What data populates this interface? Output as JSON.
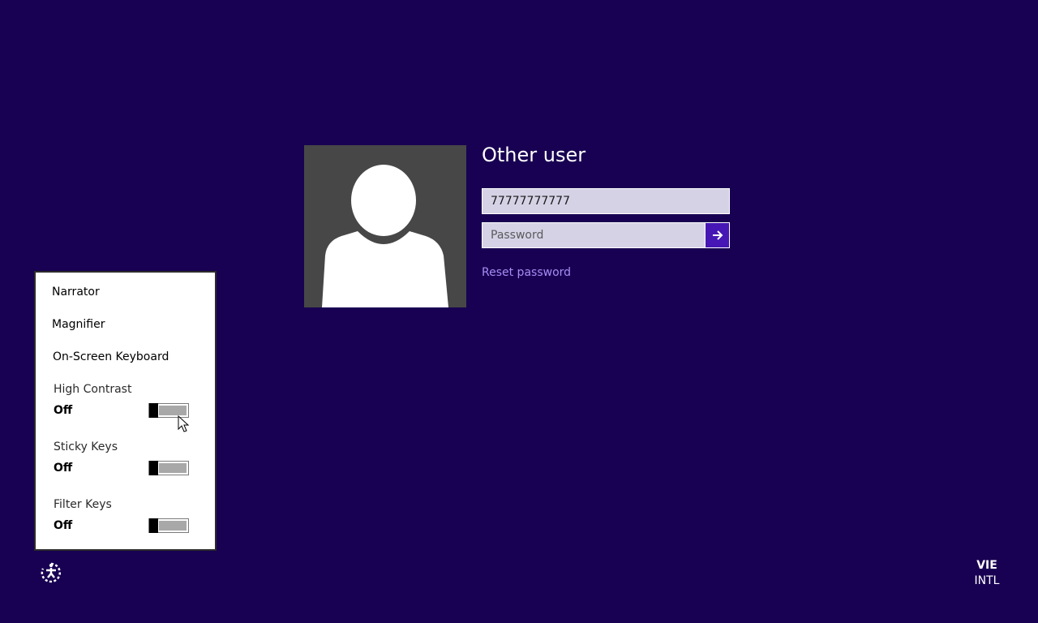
{
  "login": {
    "user_name": "Other user",
    "username_value": "77777777777",
    "password_placeholder": "Password",
    "submit_icon": "arrow-right-icon",
    "reset_password": "Reset password"
  },
  "ease_of_access": {
    "icon": "ease-of-access-icon",
    "items": [
      {
        "label": "Narrator"
      },
      {
        "label": "Magnifier"
      },
      {
        "label": "On-Screen Keyboard"
      }
    ],
    "toggles": [
      {
        "label": "High Contrast",
        "state": "Off",
        "on": false
      },
      {
        "label": "Sticky Keys",
        "state": "Off",
        "on": false
      },
      {
        "label": "Filter Keys",
        "state": "Off",
        "on": false
      }
    ]
  },
  "language": {
    "code": "VIE",
    "layout": "INTL"
  },
  "colors": {
    "background": "#180052",
    "accent": "#4617b4",
    "link": "#a78df5"
  }
}
